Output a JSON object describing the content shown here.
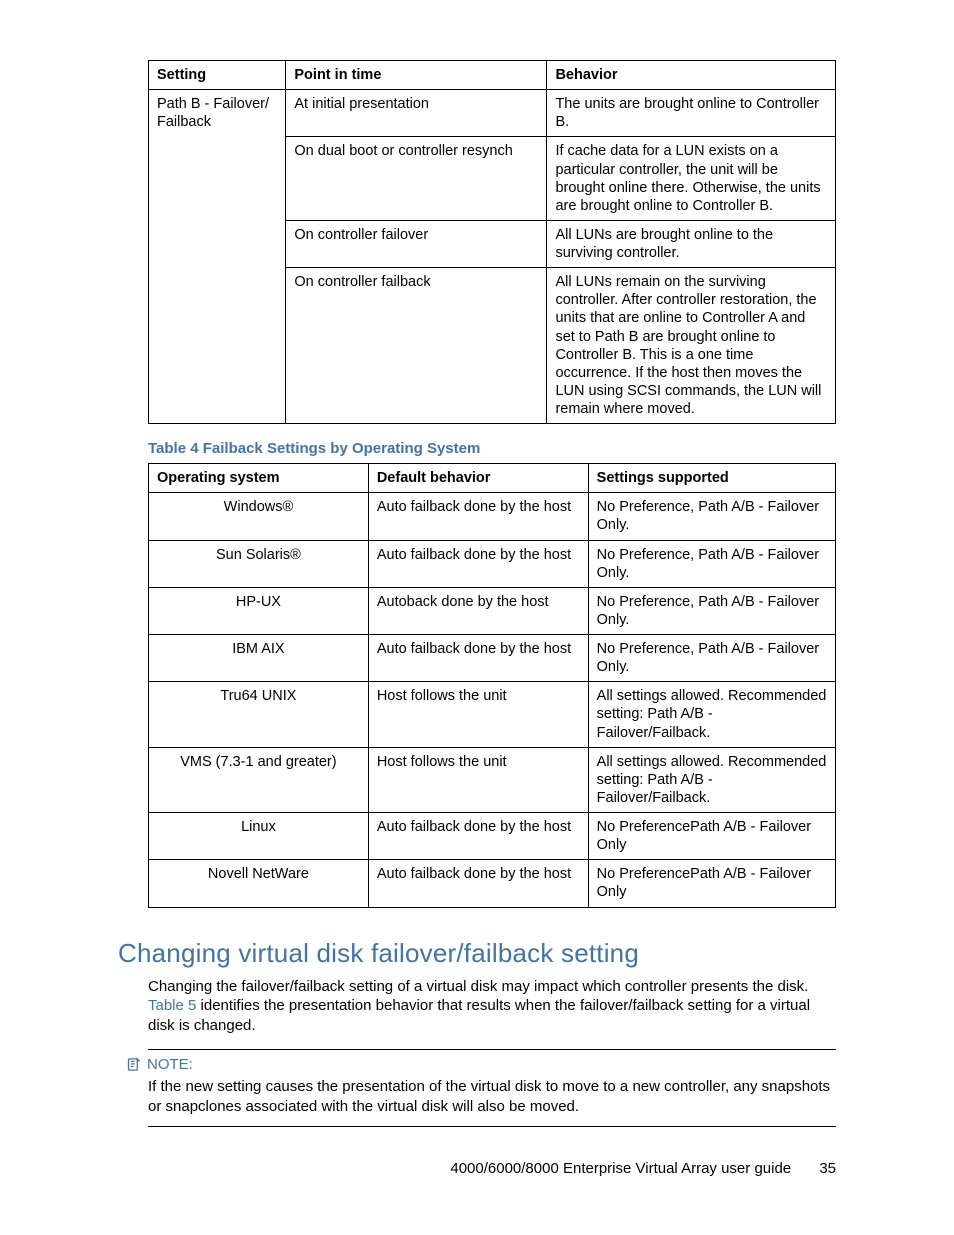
{
  "table3": {
    "headers": [
      "Setting",
      "Point in time",
      "Behavior"
    ],
    "setting": "Path B - Failover/ Failback",
    "rows": [
      {
        "point": "At initial presentation",
        "behavior": "The units are brought online to Controller B."
      },
      {
        "point": "On dual boot or controller resynch",
        "behavior": "If cache data for a LUN exists on a particular controller, the unit will be brought online there.  Otherwise, the units are brought online to Controller B."
      },
      {
        "point": "On controller failover",
        "behavior": "All LUNs are brought online to the surviving controller."
      },
      {
        "point": "On controller failback",
        "behavior": "All LUNs remain on the surviving controller.  After controller restoration, the units that are online to Controller A and set to Path B are brought online to Controller B. This is a one time occurrence.  If the host then moves the LUN using SCSI commands, the LUN will remain where moved."
      }
    ]
  },
  "table4": {
    "caption": "Table 4 Failback Settings by Operating System",
    "headers": [
      "Operating system",
      "Default behavior",
      "Settings supported"
    ],
    "rows": [
      {
        "os": "Windows®",
        "def": "Auto failback done by the host",
        "sup": "No Preference, Path A/B - Failover Only."
      },
      {
        "os": "Sun Solaris®",
        "def": "Auto failback done by the host",
        "sup": "No Preference, Path A/B - Failover Only."
      },
      {
        "os": "HP-UX",
        "def": "Autoback done by the host",
        "sup": "No Preference, Path A/B - Failover Only."
      },
      {
        "os": "IBM AIX",
        "def": "Auto failback done by the host",
        "sup": "No Preference, Path A/B - Failover Only."
      },
      {
        "os": "Tru64 UNIX",
        "def": "Host follows the unit",
        "sup": "All settings allowed.  Recommended setting:  Path A/B - Failover/Failback."
      },
      {
        "os": "VMS (7.3-1 and greater)",
        "def": "Host follows the unit",
        "sup": "All settings allowed.  Recommended setting:  Path A/B - Failover/Failback."
      },
      {
        "os": "Linux",
        "def": "Auto failback done by the host",
        "sup": "No PreferencePath A/B - Failover Only"
      },
      {
        "os": "Novell NetWare",
        "def": "Auto failback done by the host",
        "sup": "No PreferencePath A/B - Failover Only"
      }
    ]
  },
  "section": {
    "title": "Changing virtual disk failover/failback setting",
    "para_pre": "Changing the failover/failback setting of a virtual disk may impact which controller presents the disk. ",
    "para_link": "Table 5",
    "para_post": " identifies the presentation behavior that results when the failover/failback setting for a virtual disk is changed."
  },
  "note": {
    "label": "NOTE:",
    "body": "If the new setting causes the presentation of the virtual disk to move to a new controller, any snapshots or snapclones associated with the virtual disk will also be moved."
  },
  "footer": {
    "text": "4000/6000/8000 Enterprise Virtual Array user guide",
    "page": "35"
  }
}
